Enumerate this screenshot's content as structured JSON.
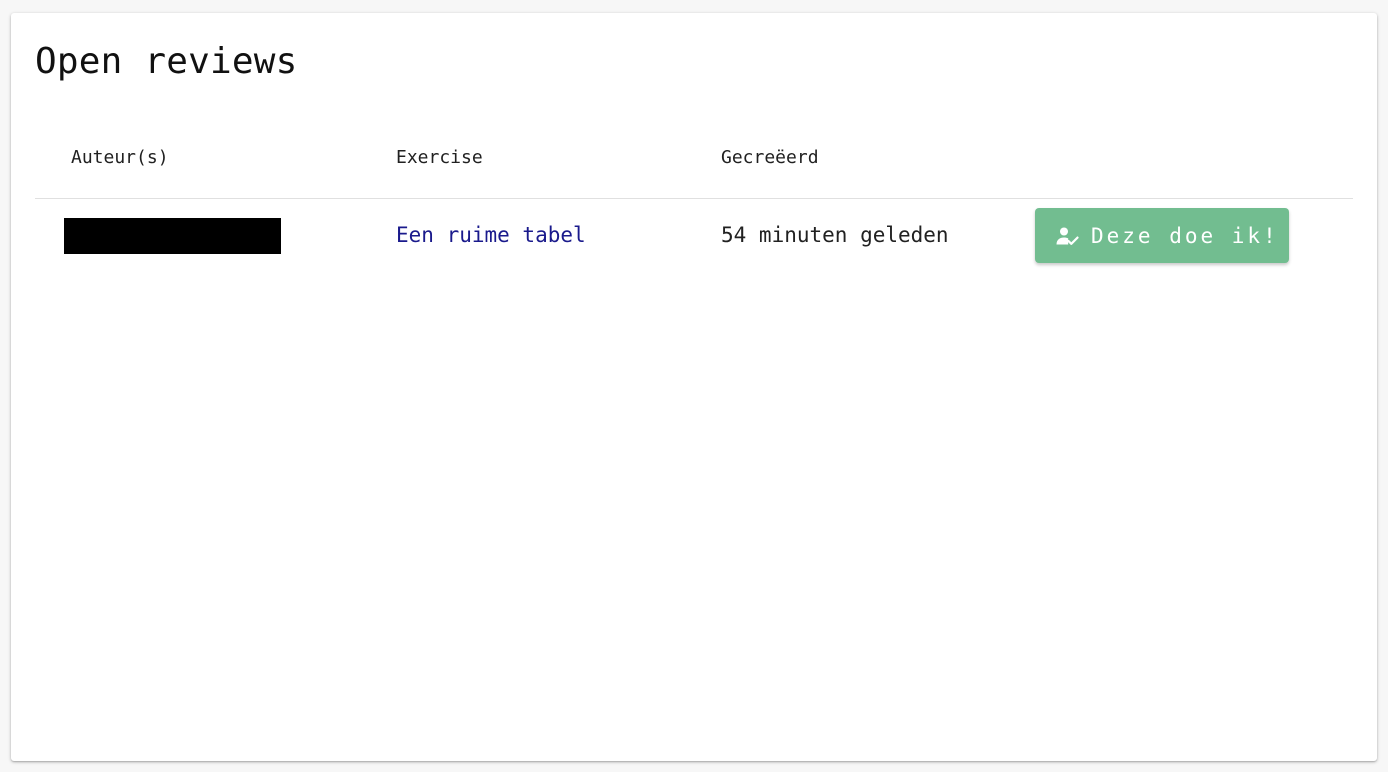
{
  "page": {
    "title": "Open reviews"
  },
  "table": {
    "headers": {
      "authors": "Auteur(s)",
      "exercise": "Exercise",
      "created": "Gecreëerd"
    },
    "rows": [
      {
        "exercise": "Een ruime tabel",
        "created": "54 minuten geleden",
        "action_label": "Deze doe ik!"
      }
    ]
  },
  "colors": {
    "accent_button": "#72bd90",
    "link": "#1a1a8c"
  },
  "icons": {
    "action": "person-check-icon"
  }
}
